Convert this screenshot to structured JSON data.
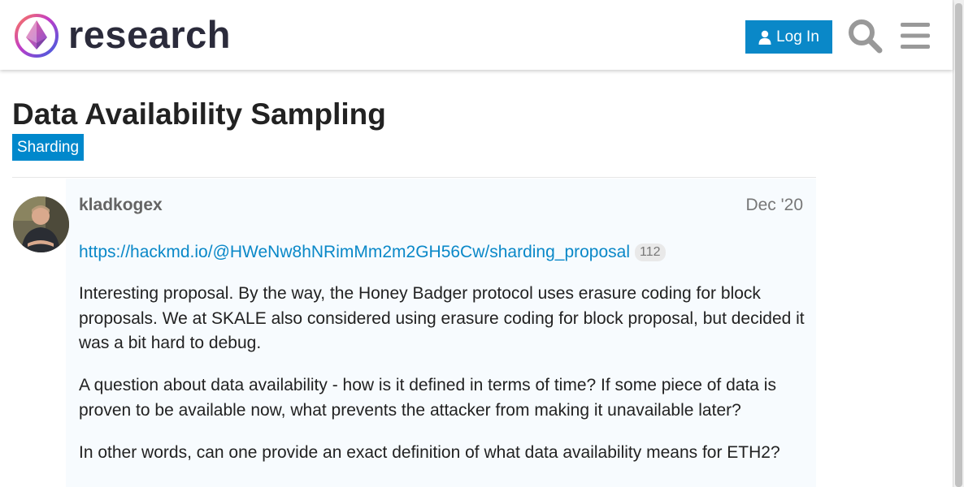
{
  "header": {
    "site_name": "research",
    "login_label": "Log In",
    "icons": {
      "logo": "research-logo-icon",
      "user": "user-icon",
      "search": "search-icon",
      "menu": "hamburger-menu-icon"
    }
  },
  "topic": {
    "title": "Data Availability Sampling",
    "category": "Sharding"
  },
  "post": {
    "username": "kladkogex",
    "date": "Dec '20",
    "link": {
      "text": "https://hackmd.io/@HWeNw8hNRimMm2m2GH56Cw/sharding_proposal",
      "click_count": "112"
    },
    "paragraphs": [
      "Interesting proposal. By the way, the Honey Badger protocol uses erasure coding for block proposals. We at SKALE also considered using erasure coding for block proposal, but decided it was a bit hard to debug.",
      "A question about data availability - how is it defined in terms of time? If some piece of data is proven to be available now, what prevents the attacker from making it unavailable later?",
      "In other words, can one provide an exact definition of what data availability means for ETH2?"
    ]
  },
  "colors": {
    "accent": "#0a88c8",
    "category": "#0088cc",
    "title": "#222222",
    "username": "#646464",
    "post_background": "#f7fbfe"
  }
}
